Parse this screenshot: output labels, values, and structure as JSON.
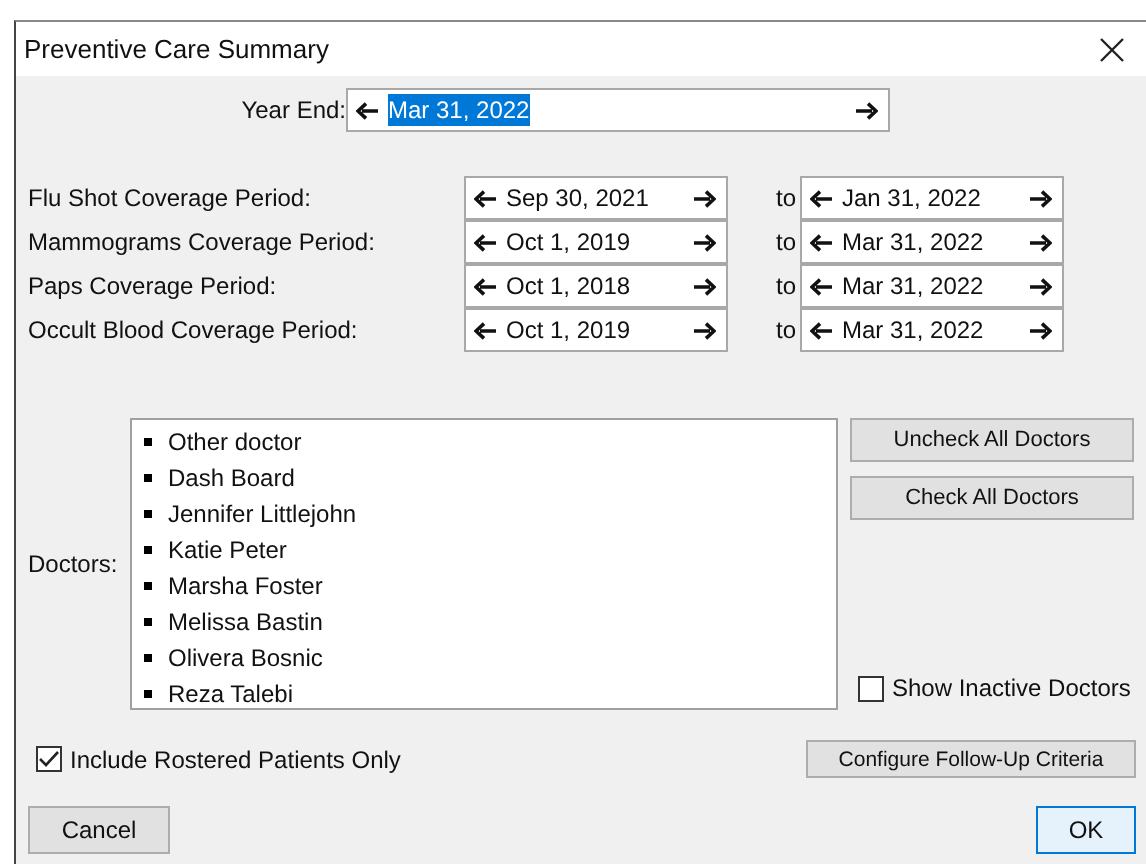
{
  "window": {
    "title": "Preventive Care Summary"
  },
  "year_end": {
    "label": "Year End:",
    "value": "Mar 31, 2022",
    "value_selected": true
  },
  "periods": [
    {
      "label": "Flu Shot Coverage Period:",
      "from": "Sep 30, 2021",
      "to_label": "to",
      "to": "Jan 31, 2022"
    },
    {
      "label": "Mammograms Coverage Period:",
      "from": "Oct 1, 2019",
      "to_label": "to",
      "to": "Mar 31, 2022"
    },
    {
      "label": "Paps Coverage Period:",
      "from": "Oct 1, 2018",
      "to_label": "to",
      "to": "Mar 31, 2022"
    },
    {
      "label": "Occult Blood Coverage Period:",
      "from": "Oct 1, 2019",
      "to_label": "to",
      "to": "Mar 31, 2022"
    }
  ],
  "doctors": {
    "label": "Doctors:",
    "items": [
      "Other doctor",
      "Dash Board",
      "Jennifer Littlejohn",
      "Katie Peter",
      "Marsha Foster",
      "Melissa Bastin",
      "Olivera Bosnic",
      "Reza Talebi"
    ]
  },
  "doctor_buttons": [
    "Uncheck All Doctors",
    "Check All Doctors"
  ],
  "show_inactive": {
    "label": "Show Inactive Doctors",
    "checked": false
  },
  "include_rostered": {
    "label": "Include Rostered Patients Only",
    "checked": true
  },
  "configure_button": "Configure Follow-Up Criteria",
  "buttons": {
    "cancel": "Cancel",
    "ok": "OK"
  }
}
